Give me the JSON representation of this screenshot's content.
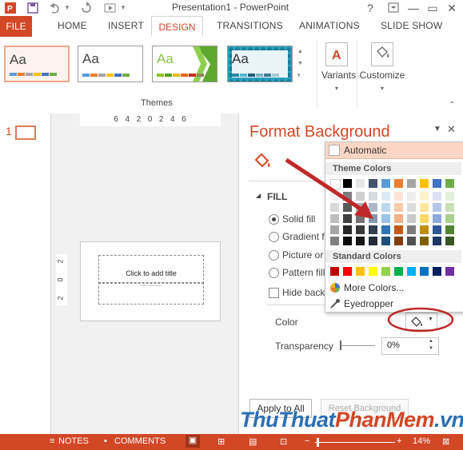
{
  "app": {
    "title": "Presentation1 - PowerPoint",
    "help": "?",
    "minimize": "—",
    "restore": "▭",
    "close": "✕"
  },
  "tabs": [
    "FILE",
    "HOME",
    "INSERT",
    "DESIGN",
    "TRANSITIONS",
    "ANIMATIONS",
    "SLIDE SHOW"
  ],
  "ribbon": {
    "theme_aa": "Aa",
    "themes_label": "Themes",
    "variants_label": "Variants",
    "customize_label": "Customize"
  },
  "slide_pane": {
    "slide_number": "1",
    "ruler_h": "6  4  2  0  2  4  6",
    "ruler_v": [
      "2",
      "0",
      "2"
    ],
    "title_placeholder": "Click to add title",
    "subtitle_placeholder": "Click to add subtitle"
  },
  "format_pane": {
    "title": "Format Background",
    "section": "FILL",
    "options": [
      "Solid fill",
      "Gradient fill",
      "Picture or texture fill",
      "Pattern fill"
    ],
    "hide_bg": "Hide background graphics",
    "color_label": "Color",
    "transparency_label": "Transparency",
    "transparency_value": "0%",
    "apply_all": "Apply to All",
    "reset": "Reset Background"
  },
  "color_menu": {
    "automatic": "Automatic",
    "theme_colors": "Theme Colors",
    "standard_colors": "Standard Colors",
    "more_colors": "More Colors...",
    "eyedropper": "Eyedropper",
    "theme_top": [
      "#ffffff",
      "#000000",
      "#e7e6e6",
      "#44546a",
      "#5b9bd5",
      "#ed7d31",
      "#a5a5a5",
      "#ffc000",
      "#4472c4",
      "#70ad47"
    ],
    "theme_cols": [
      [
        "#f2f2f2",
        "#d9d9d9",
        "#bfbfbf",
        "#a6a6a6",
        "#808080"
      ],
      [
        "#7f7f7f",
        "#595959",
        "#404040",
        "#262626",
        "#0d0d0d"
      ],
      [
        "#d0cece",
        "#aeabab",
        "#757171",
        "#3a3838",
        "#171616"
      ],
      [
        "#d6dce4",
        "#adb9ca",
        "#8496b0",
        "#333f4f",
        "#222a35"
      ],
      [
        "#ddebf7",
        "#bdd7ee",
        "#9bc2e6",
        "#2e75b6",
        "#1f4e78"
      ],
      [
        "#fce4d6",
        "#f8cbad",
        "#f4b084",
        "#c65911",
        "#843c0c"
      ],
      [
        "#ededed",
        "#dbdbdb",
        "#c9c9c9",
        "#7b7b7b",
        "#525252"
      ],
      [
        "#fff2cc",
        "#ffe699",
        "#ffd966",
        "#bf8f00",
        "#7f6000"
      ],
      [
        "#d9e1f2",
        "#b4c6e7",
        "#8ea9db",
        "#2f5597",
        "#203764"
      ],
      [
        "#e2efda",
        "#c6e0b4",
        "#a9d08e",
        "#548235",
        "#375623"
      ]
    ],
    "standard": [
      "#c00000",
      "#ff0000",
      "#ffc000",
      "#ffff00",
      "#92d050",
      "#00b050",
      "#00b0f0",
      "#0070c0",
      "#002060",
      "#7030a0"
    ]
  },
  "status": {
    "notes": "NOTES",
    "comments": "COMMENTS",
    "zoom": "14%"
  },
  "watermark": {
    "part1": "ThuThuat",
    "part2": "PhanMem",
    "part3": ".vn"
  },
  "colors": {
    "accent": "#d24726",
    "annotation_red": "#c0282a"
  }
}
